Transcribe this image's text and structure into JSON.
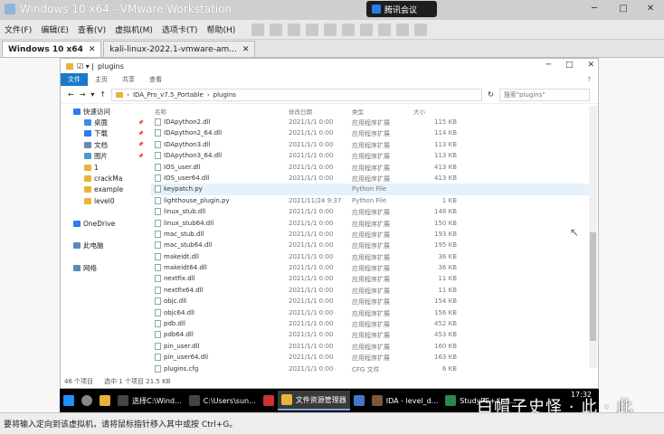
{
  "window": {
    "title": "Windows 10 x64 - VMware Workstation",
    "meeting_label": "腾讯会议"
  },
  "menu": [
    "文件(F)",
    "编辑(E)",
    "查看(V)",
    "虚拟机(M)",
    "选项卡(T)",
    "帮助(H)"
  ],
  "vm_tabs": [
    {
      "label": "Windows 10 x64",
      "active": true
    },
    {
      "label": "kali-linux-2022.1-vmware-am...",
      "active": false
    }
  ],
  "explorer": {
    "title": "plugins",
    "ribbon": [
      "文件",
      "主页",
      "共享",
      "查看"
    ],
    "path": [
      "IDA_Pro_v7.5_Portable",
      "plugins"
    ],
    "search_placeholder": "搜索\"plugins\"",
    "nav": [
      {
        "label": "快速访问",
        "icon": "star-icon"
      },
      {
        "label": "桌面",
        "icon": "desktop-icon"
      },
      {
        "label": "下载",
        "icon": "download-icon"
      },
      {
        "label": "文档",
        "icon": "document-icon"
      },
      {
        "label": "图片",
        "icon": "picture-icon"
      },
      {
        "label": "1",
        "icon": "folder-icon"
      },
      {
        "label": "crackMa",
        "icon": "folder-icon"
      },
      {
        "label": "example",
        "icon": "folder-icon"
      },
      {
        "label": "level0",
        "icon": "folder-icon"
      },
      {
        "label": "",
        "icon": ""
      },
      {
        "label": "OneDrive",
        "icon": "cloud-icon"
      },
      {
        "label": "",
        "icon": ""
      },
      {
        "label": "此电脑",
        "icon": "computer-icon"
      },
      {
        "label": "",
        "icon": ""
      },
      {
        "label": "网络",
        "icon": "network-icon"
      }
    ],
    "columns": {
      "name": "名称",
      "date": "修改日期",
      "type": "类型",
      "size": "大小"
    },
    "files": [
      {
        "name": "IDApython2.dll",
        "date": "2021/1/1 0:00",
        "type": "应用程序扩展",
        "size": "115 KB"
      },
      {
        "name": "IDApython2_64.dll",
        "date": "2021/1/1 0:00",
        "type": "应用程序扩展",
        "size": "114 KB"
      },
      {
        "name": "IDApython3.dll",
        "date": "2021/1/1 0:00",
        "type": "应用程序扩展",
        "size": "113 KB"
      },
      {
        "name": "IDApython3_64.dll",
        "date": "2021/1/1 0:00",
        "type": "应用程序扩展",
        "size": "113 KB"
      },
      {
        "name": "IOS_user.dll",
        "date": "2021/1/1 0:00",
        "type": "应用程序扩展",
        "size": "413 KB"
      },
      {
        "name": "IOS_user64.dll",
        "date": "2021/1/1 0:00",
        "type": "应用程序扩展",
        "size": "413 KB"
      },
      {
        "name": "keypatch.py",
        "date": "",
        "type": "Python File",
        "size": "",
        "selected": true
      },
      {
        "name": "lighthouse_plugin.py",
        "date": "2021/11/24 9:37",
        "type": "Python File",
        "size": "1 KB"
      },
      {
        "name": "linux_stub.dll",
        "date": "2021/1/1 0:00",
        "type": "应用程序扩展",
        "size": "148 KB"
      },
      {
        "name": "linux_stub64.dll",
        "date": "2021/1/1 0:00",
        "type": "应用程序扩展",
        "size": "150 KB"
      },
      {
        "name": "mac_stub.dll",
        "date": "2021/1/1 0:00",
        "type": "应用程序扩展",
        "size": "193 KB"
      },
      {
        "name": "mac_stub64.dll",
        "date": "2021/1/1 0:00",
        "type": "应用程序扩展",
        "size": "195 KB"
      },
      {
        "name": "makeidt.dll",
        "date": "2021/1/1 0:00",
        "type": "应用程序扩展",
        "size": "36 KB"
      },
      {
        "name": "makeidt64.dll",
        "date": "2021/1/1 0:00",
        "type": "应用程序扩展",
        "size": "36 KB"
      },
      {
        "name": "nextfix.dll",
        "date": "2021/1/1 0:00",
        "type": "应用程序扩展",
        "size": "11 KB"
      },
      {
        "name": "nextfix64.dll",
        "date": "2021/1/1 0:00",
        "type": "应用程序扩展",
        "size": "11 KB"
      },
      {
        "name": "objc.dll",
        "date": "2021/1/1 0:00",
        "type": "应用程序扩展",
        "size": "154 KB"
      },
      {
        "name": "objc64.dll",
        "date": "2021/1/1 0:00",
        "type": "应用程序扩展",
        "size": "156 KB"
      },
      {
        "name": "pdb.dll",
        "date": "2021/1/1 0:00",
        "type": "应用程序扩展",
        "size": "452 KB"
      },
      {
        "name": "pdb64.dll",
        "date": "2021/1/1 0:00",
        "type": "应用程序扩展",
        "size": "453 KB"
      },
      {
        "name": "pin_user.dll",
        "date": "2021/1/1 0:00",
        "type": "应用程序扩展",
        "size": "160 KB"
      },
      {
        "name": "pin_user64.dll",
        "date": "2021/1/1 0:00",
        "type": "应用程序扩展",
        "size": "163 KB"
      },
      {
        "name": "plugins.cfg",
        "date": "2021/1/1 0:00",
        "type": "CFG 文件",
        "size": "6 KB"
      }
    ],
    "status": {
      "count": "46 个项目",
      "selected": "选中 1 个项目 21.5 KB"
    }
  },
  "taskbar": {
    "items": [
      {
        "label": "",
        "icon": "windows-icon",
        "color": "#1e90ff"
      },
      {
        "label": "",
        "icon": "search-icon",
        "color": "#888888"
      },
      {
        "label": "",
        "icon": "chrome-icon",
        "color": "#e8b13a"
      },
      {
        "label": "选择C:\\Wind...",
        "icon": "cmd-icon",
        "color": "#444444"
      },
      {
        "label": "C:\\Users\\sun...",
        "icon": "cmd-icon",
        "color": "#444444"
      },
      {
        "label": "",
        "icon": "app-icon",
        "color": "#cc3333"
      },
      {
        "label": "文件资源管理器",
        "icon": "folder-icon",
        "color": "#e7b53a",
        "active": true
      },
      {
        "label": "",
        "icon": "app-icon",
        "color": "#4477cc"
      },
      {
        "label": "IDA - level_d...",
        "icon": "ida-icon",
        "color": "#7a5a3a"
      },
      {
        "label": "StudyPE+ (x6...",
        "icon": "pe-icon",
        "color": "#2a8a4a"
      }
    ],
    "time": "17:32"
  },
  "watermark": "白帽子史怿 · 此 · 此",
  "hint": "要将输入定向到该虚拟机，请将鼠标指针移入其中或按 Ctrl+G。"
}
